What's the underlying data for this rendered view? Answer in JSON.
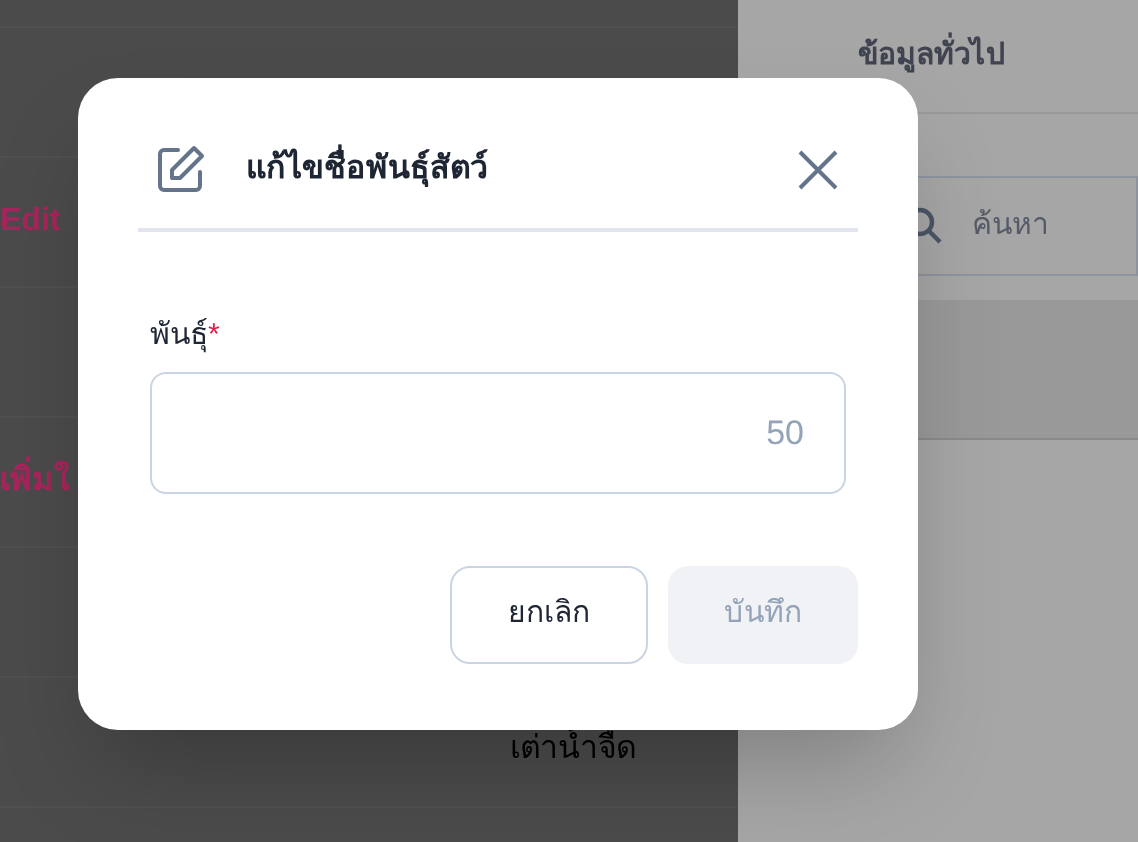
{
  "background": {
    "rows": [
      {
        "kind": "link",
        "text": "Edit"
      },
      {
        "kind": "link",
        "text": "เพิ่มใ"
      },
      {
        "kind": "name",
        "text": "เต่าน้ำจืด"
      }
    ]
  },
  "side_panel": {
    "tab": "ข้อมูลทั่วไป",
    "search": {
      "placeholder": "ค้นหา"
    }
  },
  "dialog": {
    "title": "แก้ไขชื่อพันธุ์สัตว์",
    "field": {
      "label": "พันธุ์",
      "required_mark": "*",
      "placeholder": "50"
    },
    "buttons": [
      {
        "kind": "secondary",
        "label": "ยกเลิก",
        "disabled": false
      },
      {
        "kind": "primary",
        "label": "บันทึก",
        "disabled": true
      }
    ]
  }
}
